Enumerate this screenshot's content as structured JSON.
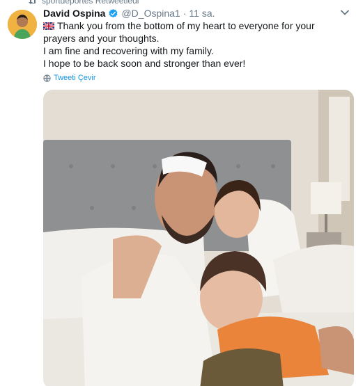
{
  "retweet": {
    "label": "sportdeportes Retweetledi"
  },
  "author": {
    "name": "David Ospina",
    "handle": "@D_Ospina1",
    "time": "11 sa."
  },
  "tweet": {
    "lines": [
      "Thank you from the bottom of my heart to everyone for your prayers and your thoughts.",
      "I am fine and recovering with my family.",
      "I hope to be back soon and stronger than ever!"
    ],
    "translate_label": "Tweeti Çevir"
  },
  "icons": {
    "retweet": "retweet-icon",
    "verified": "verified-badge-icon",
    "flag": "uk-flag-icon",
    "more": "chevron-down-icon",
    "translate": "globe-icon"
  },
  "colors": {
    "link": "#1b95e0",
    "muted": "#657786",
    "text": "#14171a"
  }
}
